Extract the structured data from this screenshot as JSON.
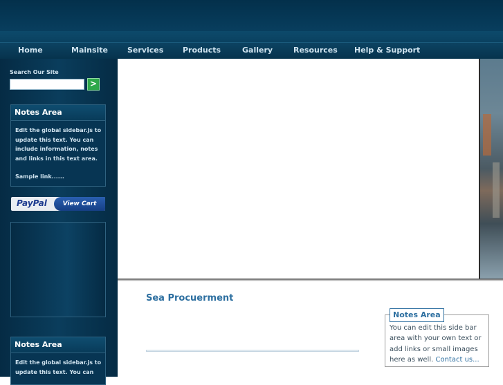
{
  "nav": {
    "items": [
      {
        "label": "Home"
      },
      {
        "label": "Mainsite"
      },
      {
        "label": "Services"
      },
      {
        "label": "Products"
      },
      {
        "label": "Gallery"
      },
      {
        "label": "Resources"
      },
      {
        "label": "Help & Support"
      }
    ]
  },
  "sidebar": {
    "search_label": "Search Our Site",
    "search_value": "",
    "search_button": ">",
    "notes1": {
      "title": "Notes Area",
      "text": "Edit the global sidebar.js to update this text. You can include information, notes and links in this text area.",
      "link": "Sample link......"
    },
    "paypal": {
      "logo": "PayPal",
      "button": "View Cart"
    },
    "notes2": {
      "title": "Notes Area",
      "text": "Edit the global sidebar.js to update this text. You can"
    }
  },
  "main": {
    "title": "Sea Procuerment"
  },
  "right_notes": {
    "title": "Notes Area",
    "text": "You can edit this side bar area with your own text or add links or small images here as well.",
    "link": "Contact us..."
  }
}
